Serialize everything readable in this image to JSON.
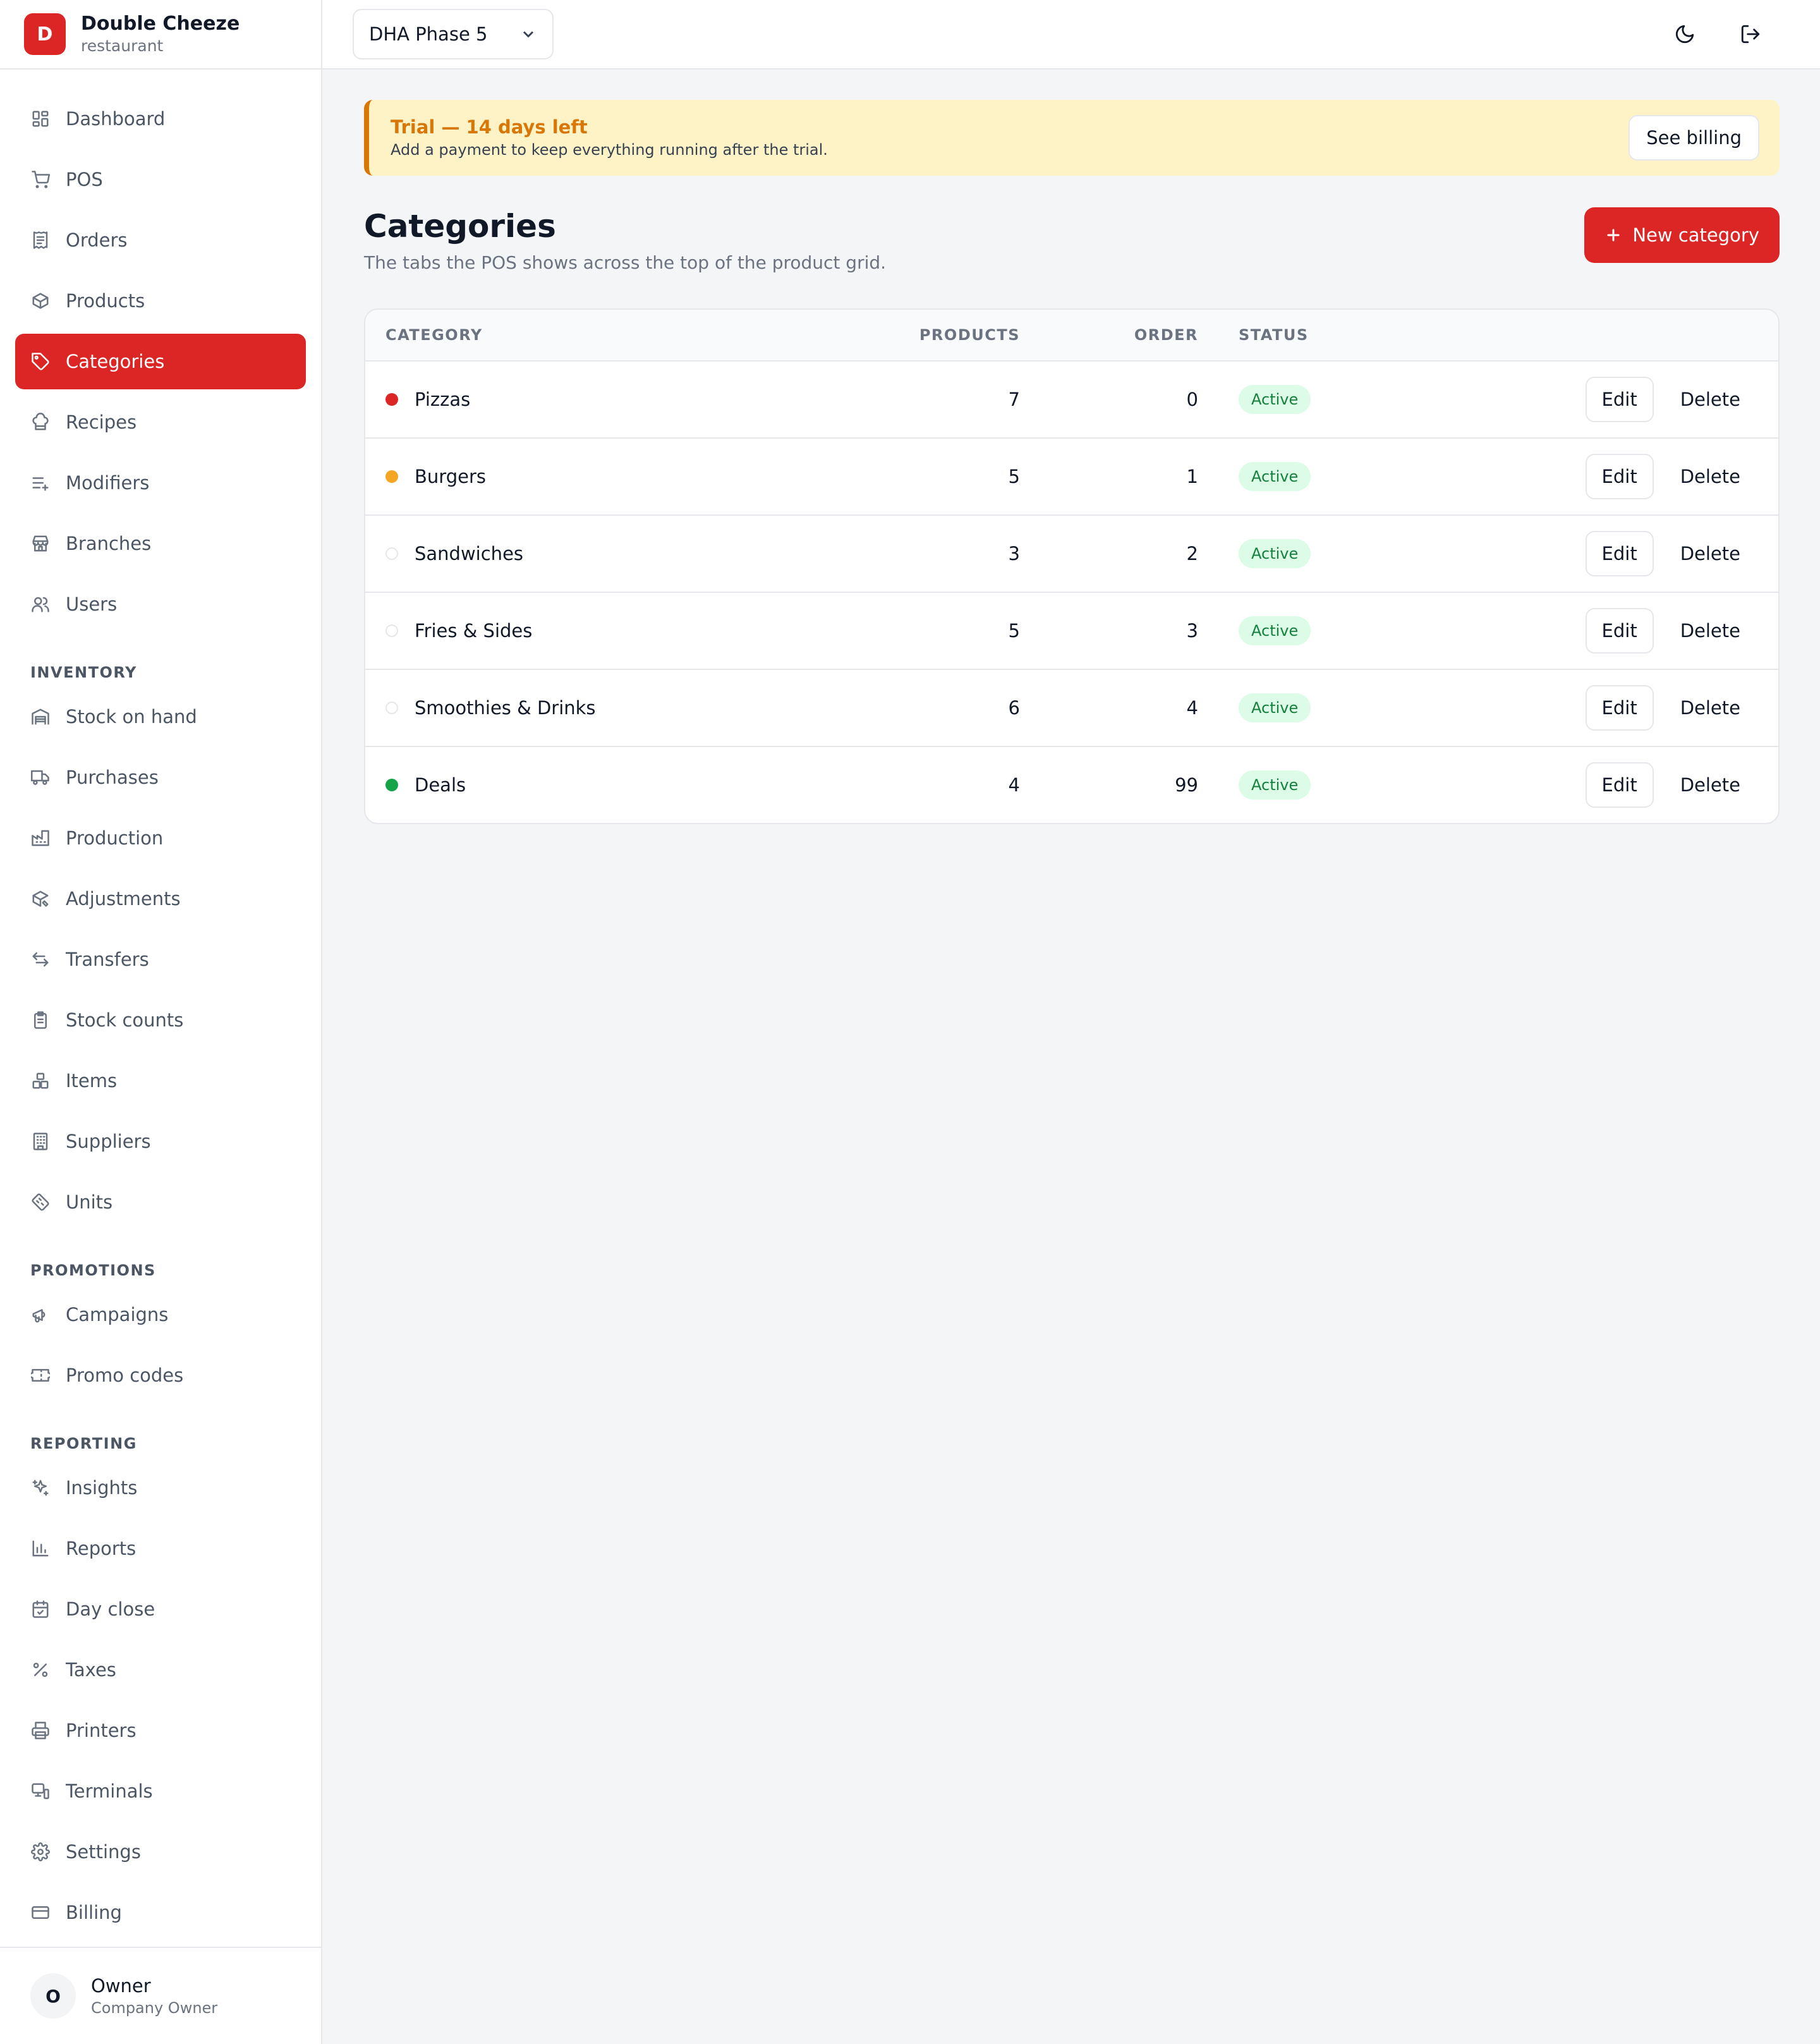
{
  "brand": {
    "initial": "D",
    "name": "Double Cheeze",
    "subtitle": "restaurant"
  },
  "sidebar": {
    "main": [
      {
        "label": "Dashboard",
        "icon": "dashboard-icon"
      },
      {
        "label": "POS",
        "icon": "cart-icon"
      },
      {
        "label": "Orders",
        "icon": "receipt-icon"
      },
      {
        "label": "Products",
        "icon": "package-icon"
      },
      {
        "label": "Categories",
        "icon": "tag-icon",
        "active": true
      },
      {
        "label": "Recipes",
        "icon": "chef-hat-icon"
      },
      {
        "label": "Modifiers",
        "icon": "list-plus-icon"
      },
      {
        "label": "Branches",
        "icon": "store-icon"
      },
      {
        "label": "Users",
        "icon": "users-icon"
      }
    ],
    "inventory_title": "INVENTORY",
    "inventory": [
      {
        "label": "Stock on hand",
        "icon": "warehouse-icon"
      },
      {
        "label": "Purchases",
        "icon": "truck-icon"
      },
      {
        "label": "Production",
        "icon": "factory-icon"
      },
      {
        "label": "Adjustments",
        "icon": "package-edit-icon"
      },
      {
        "label": "Transfers",
        "icon": "transfer-icon"
      },
      {
        "label": "Stock counts",
        "icon": "clipboard-icon"
      },
      {
        "label": "Items",
        "icon": "boxes-icon"
      },
      {
        "label": "Suppliers",
        "icon": "building-icon"
      },
      {
        "label": "Units",
        "icon": "ruler-icon"
      }
    ],
    "promotions_title": "PROMOTIONS",
    "promotions": [
      {
        "label": "Campaigns",
        "icon": "megaphone-icon"
      },
      {
        "label": "Promo codes",
        "icon": "ticket-icon"
      }
    ],
    "reporting_title": "REPORTING",
    "reporting": [
      {
        "label": "Insights",
        "icon": "sparkles-icon"
      },
      {
        "label": "Reports",
        "icon": "bar-chart-icon"
      },
      {
        "label": "Day close",
        "icon": "calendar-check-icon"
      },
      {
        "label": "Taxes",
        "icon": "percent-icon"
      },
      {
        "label": "Printers",
        "icon": "printer-icon"
      },
      {
        "label": "Terminals",
        "icon": "monitor-icon"
      },
      {
        "label": "Settings",
        "icon": "gear-icon"
      },
      {
        "label": "Billing",
        "icon": "credit-card-icon"
      }
    ]
  },
  "user": {
    "initial": "O",
    "name": "Owner",
    "role": "Company Owner"
  },
  "topbar": {
    "branch": "DHA Phase 5"
  },
  "trial": {
    "title": "Trial — 14 days left",
    "subtitle": "Add a payment to keep everything running after the trial.",
    "button": "See billing"
  },
  "page": {
    "title": "Categories",
    "subtitle": "The tabs the POS shows across the top of the product grid.",
    "new_button": "New category"
  },
  "table": {
    "headers": {
      "category": "CATEGORY",
      "products": "PRODUCTS",
      "order": "ORDER",
      "status": "STATUS"
    },
    "edit_label": "Edit",
    "delete_label": "Delete",
    "rows": [
      {
        "name": "Pizzas",
        "products": "7",
        "order": "0",
        "status": "Active",
        "color": "#dc2626"
      },
      {
        "name": "Burgers",
        "products": "5",
        "order": "1",
        "status": "Active",
        "color": "#f5a524"
      },
      {
        "name": "Sandwiches",
        "products": "3",
        "order": "2",
        "status": "Active",
        "color": "#ffffff"
      },
      {
        "name": "Fries & Sides",
        "products": "5",
        "order": "3",
        "status": "Active",
        "color": "#ffffff"
      },
      {
        "name": "Smoothies & Drinks",
        "products": "6",
        "order": "4",
        "status": "Active",
        "color": "#ffffff"
      },
      {
        "name": "Deals",
        "products": "4",
        "order": "99",
        "status": "Active",
        "color": "#16a34a"
      }
    ]
  }
}
